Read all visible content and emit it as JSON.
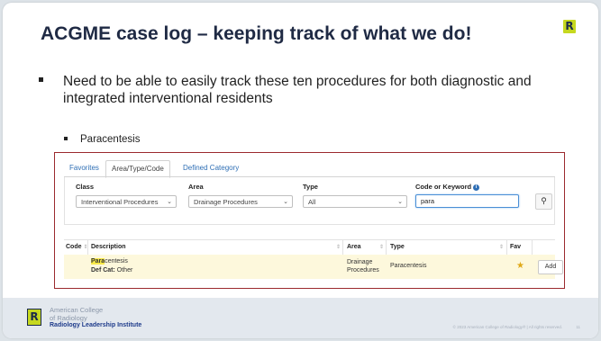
{
  "slide": {
    "title": "ACGME case log – keeping track of what we do!",
    "logo_letter": "R",
    "bullet1": "Need to be able to easily track these ten procedures for both diagnostic and integrated interventional residents",
    "bullet2": "Paracentesis"
  },
  "tabs": [
    {
      "label": "Favorites",
      "active": false
    },
    {
      "label": "Area/Type/Code",
      "active": true
    },
    {
      "label": "Defined Category",
      "active": false
    }
  ],
  "filters": {
    "class": {
      "label": "Class",
      "value": "Interventional Procedures"
    },
    "area": {
      "label": "Area",
      "value": "Drainage Procedures"
    },
    "type": {
      "label": "Type",
      "value": "All"
    },
    "keyword": {
      "label": "Code or Keyword",
      "value": "para"
    }
  },
  "table": {
    "headers": {
      "code": "Code",
      "description": "Description",
      "area": "Area",
      "type": "Type",
      "fav": "Fav"
    },
    "row": {
      "desc_highlight": "Para",
      "desc_rest": "centesis",
      "defcat_label": "Def Cat:",
      "defcat_value": "Other",
      "area": "Drainage Procedures",
      "type": "Paracentesis",
      "fav_icon": "star-icon",
      "add_label": "Add"
    }
  },
  "footer": {
    "org_line1": "American College",
    "org_line2": "of Radiology",
    "institute": "Radiology Leadership Institute",
    "copyright": "© 2023 American College of Radiology® | All rights reserved.",
    "page": "11"
  },
  "colors": {
    "accent": "#c6d81f",
    "frame": "#9b2a2e",
    "link": "#2f6fb5",
    "highlight": "#f7e94a"
  }
}
